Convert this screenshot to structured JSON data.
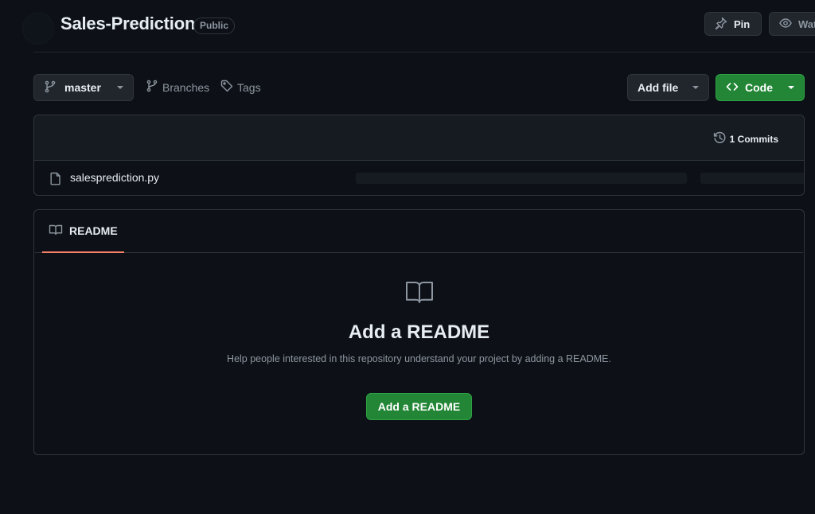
{
  "header": {
    "repo_name": "Sales-Prediction",
    "visibility": "Public",
    "pin_label": "Pin",
    "watch_label": "Watch"
  },
  "toolbar": {
    "branch": "master",
    "branches_label": "Branches",
    "tags_label": "Tags",
    "add_file_label": "Add file",
    "code_label": "Code"
  },
  "files": {
    "commits_label": "1 Commits",
    "items": [
      {
        "name": "salesprediction.py",
        "icon": "file-icon"
      }
    ]
  },
  "readme": {
    "tab_label": "README",
    "empty_title": "Add a README",
    "empty_description": "Help people interested in this repository understand your project by adding a README.",
    "add_button_label": "Add a README"
  },
  "colors": {
    "background": "#0d1117",
    "accent_green": "#238636",
    "tab_underline": "#f78166",
    "muted_text": "#8d96a0"
  }
}
